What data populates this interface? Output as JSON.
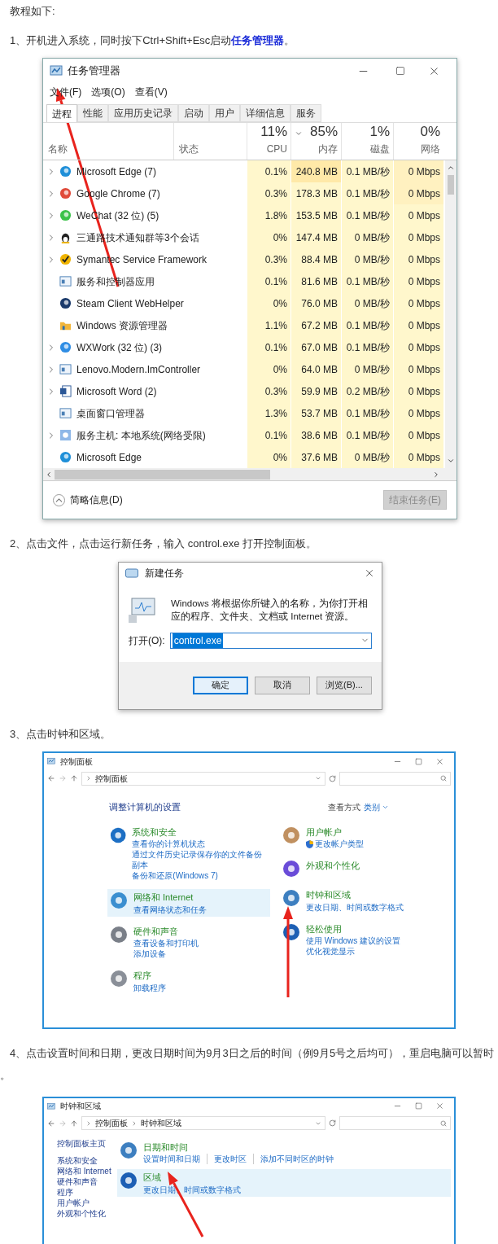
{
  "intro": "教程如下:",
  "step_1": "1、开机进入系统，同时按下Ctrl+Shift+Esc启动**任务管理器**。",
  "task_manager": {
    "title": "任务管理器",
    "menu": [
      "文件(F)",
      "选项(O)",
      "查看(V)"
    ],
    "tabs": [
      {
        "label": "进程",
        "selected": true
      },
      {
        "label": "性能",
        "selected": false
      },
      {
        "label": "应用历史记录",
        "selected": false
      },
      {
        "label": "启动",
        "selected": false
      },
      {
        "label": "用户",
        "selected": false
      },
      {
        "label": "详细信息",
        "selected": false
      },
      {
        "label": "服务",
        "selected": false
      }
    ],
    "name_column": "名称",
    "status_column": "状态",
    "columns": [
      {
        "percent": "11%",
        "label": "CPU",
        "sorted": false
      },
      {
        "percent": "85%",
        "label": "内存",
        "sorted": true
      },
      {
        "percent": "1%",
        "label": "磁盘",
        "sorted": false
      },
      {
        "percent": "0%",
        "label": "网络",
        "sorted": false
      }
    ],
    "rows": [
      {
        "name": "Microsoft Edge (7)",
        "expandable": true,
        "cpu": "0.1%",
        "memory": "240.8 MB",
        "disk": "0.1 MB/秒",
        "network": "0 Mbps"
      },
      {
        "name": "Google Chrome (7)",
        "expandable": true,
        "cpu": "0.3%",
        "memory": "178.3 MB",
        "disk": "0.1 MB/秒",
        "network": "0 Mbps"
      },
      {
        "name": "WeChat (32 位) (5)",
        "expandable": true,
        "cpu": "1.8%",
        "memory": "153.5 MB",
        "disk": "0.1 MB/秒",
        "network": "0 Mbps"
      },
      {
        "name": "三通路技术通知群等3个会话",
        "expandable": true,
        "cpu": "0%",
        "memory": "147.4 MB",
        "disk": "0 MB/秒",
        "network": "0 Mbps"
      },
      {
        "name": "Symantec Service Framework",
        "expandable": true,
        "cpu": "0.3%",
        "memory": "88.4 MB",
        "disk": "0 MB/秒",
        "network": "0 Mbps"
      },
      {
        "name": "服务和控制器应用",
        "expandable": false,
        "cpu": "0.1%",
        "memory": "81.6 MB",
        "disk": "0.1 MB/秒",
        "network": "0 Mbps"
      },
      {
        "name": "Steam Client WebHelper",
        "expandable": false,
        "cpu": "0%",
        "memory": "76.0 MB",
        "disk": "0 MB/秒",
        "network": "0 Mbps"
      },
      {
        "name": "Windows 资源管理器",
        "expandable": false,
        "cpu": "1.1%",
        "memory": "67.2 MB",
        "disk": "0.1 MB/秒",
        "network": "0 Mbps"
      },
      {
        "name": "WXWork (32 位) (3)",
        "expandable": true,
        "cpu": "0.1%",
        "memory": "67.0 MB",
        "disk": "0.1 MB/秒",
        "network": "0 Mbps"
      },
      {
        "name": "Lenovo.Modern.ImController",
        "expandable": true,
        "cpu": "0%",
        "memory": "64.0 MB",
        "disk": "0 MB/秒",
        "network": "0 Mbps"
      },
      {
        "name": "Microsoft Word (2)",
        "expandable": true,
        "cpu": "0.3%",
        "memory": "59.9 MB",
        "disk": "0.2 MB/秒",
        "network": "0 Mbps"
      },
      {
        "name": "桌面窗口管理器",
        "expandable": false,
        "cpu": "1.3%",
        "memory": "53.7 MB",
        "disk": "0.1 MB/秒",
        "network": "0 Mbps"
      },
      {
        "name": "服务主机: 本地系统(网络受限)",
        "expandable": true,
        "cpu": "0.1%",
        "memory": "38.6 MB",
        "disk": "0.1 MB/秒",
        "network": "0 Mbps"
      },
      {
        "name": "Microsoft Edge",
        "expandable": false,
        "cpu": "0%",
        "memory": "37.6 MB",
        "disk": "0 MB/秒",
        "network": "0 Mbps"
      }
    ],
    "details": "简略信息(D)",
    "end_task": {
      "label": "结束任务(E)",
      "disabled": true
    }
  },
  "step_2": "2、点击文件，点击运行新任务，输入 control.exe 打开控制面板。",
  "new_task_dialog": {
    "title": "新建任务",
    "message": "Windows 将根据你所键入的名称，为你打开相应的程序、文件夹、文档或 Internet 资源。",
    "open_label": "打开(O):",
    "value": "control.exe",
    "buttons": [
      {
        "label": "确定",
        "default": true
      },
      {
        "label": "取消",
        "default": false
      },
      {
        "label": "浏览(B)...",
        "default": false
      }
    ]
  },
  "step_3": "3、点击时钟和区域。",
  "control_panel": {
    "title": "控制面板",
    "address": [
      "控制面板"
    ],
    "heading": "调整计算机的设置",
    "view_by_label": "查看方式",
    "view_by_value": "类别",
    "columns": [
      [
        {
          "title": "系统和安全",
          "highlighted": false,
          "links": [
            {
              "text": "查看你的计算机状态",
              "shield": false
            },
            {
              "text": "通过文件历史记录保存你的文件备份副本",
              "shield": false
            },
            {
              "text": "备份和还原(Windows 7)",
              "shield": false
            }
          ]
        },
        {
          "title": "网络和 Internet",
          "highlighted": true,
          "links": [
            {
              "text": "查看网络状态和任务",
              "shield": false
            }
          ]
        },
        {
          "title": "硬件和声音",
          "highlighted": false,
          "links": [
            {
              "text": "查看设备和打印机",
              "shield": false
            },
            {
              "text": "添加设备",
              "shield": false
            }
          ]
        },
        {
          "title": "程序",
          "highlighted": false,
          "links": [
            {
              "text": "卸载程序",
              "shield": false
            }
          ]
        }
      ],
      [
        {
          "title": "用户帐户",
          "highlighted": false,
          "links": [
            {
              "text": "更改帐户类型",
              "shield": true
            }
          ]
        },
        {
          "title": "外观和个性化",
          "highlighted": false
        },
        {
          "title": "时钟和区域",
          "highlighted": false,
          "links": [
            {
              "text": "更改日期、时间或数字格式",
              "shield": false
            }
          ]
        },
        {
          "title": "轻松使用",
          "highlighted": false,
          "links": [
            {
              "text": "使用 Windows 建议的设置",
              "shield": false
            },
            {
              "text": "优化视觉显示",
              "shield": false
            }
          ]
        }
      ]
    ]
  },
  "step_4": [
    "4、点击设置时间和日期，更改日期时间为9月3日之后的时间（例9月5号之后均可），重启电脑可以暂时",
    "。"
  ],
  "clock_region_window": {
    "title": "时钟和区域",
    "address": [
      "控制面板",
      "时钟和区域"
    ],
    "sidebar": [
      "控制面板主页",
      "系统和安全",
      "网络和 Internet",
      "硬件和声音",
      "程序",
      "用户帐户",
      "外观和个性化"
    ],
    "categories": [
      {
        "title": "日期和时间",
        "highlighted": false,
        "links": [
          "设置时间和日期",
          "更改时区",
          "添加不同时区的时钟"
        ]
      },
      {
        "title": "区域",
        "highlighted": true,
        "links": [
          "更改日期、时间或数字格式"
        ]
      }
    ]
  }
}
